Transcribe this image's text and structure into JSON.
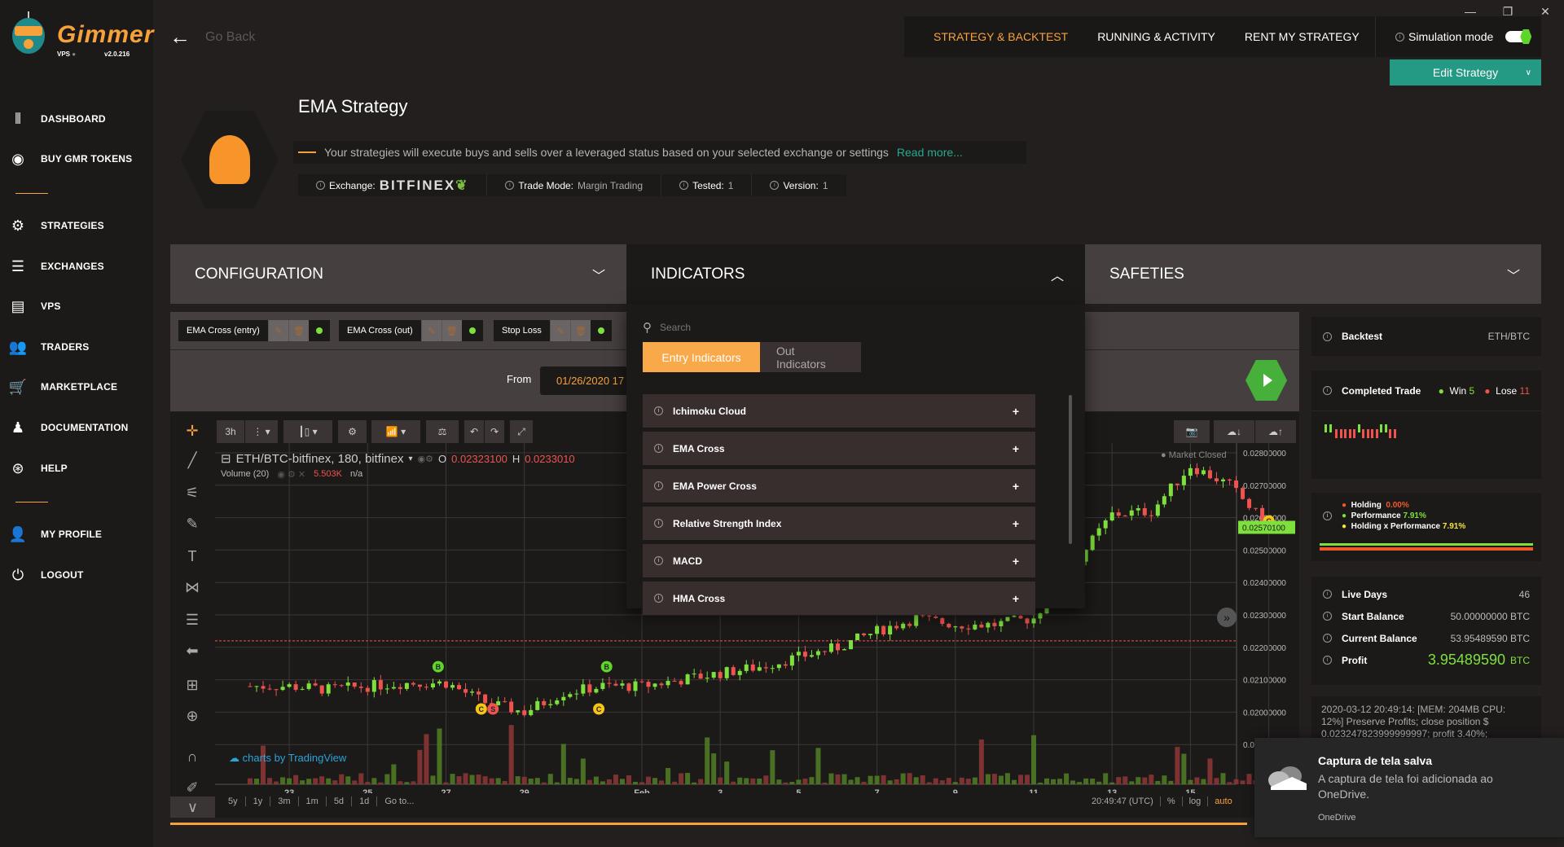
{
  "app": {
    "logo_text": "Gimmer",
    "vps_label": "VPS",
    "version": "v2.0.216"
  },
  "sidebar": {
    "items": [
      {
        "label": "DASHBOARD",
        "icon": "dashboard-icon"
      },
      {
        "label": "BUY GMR TOKENS",
        "icon": "token-icon"
      },
      {
        "label": "STRATEGIES",
        "icon": "strategies-icon"
      },
      {
        "label": "EXCHANGES",
        "icon": "exchanges-icon"
      },
      {
        "label": "VPS",
        "icon": "vps-icon"
      },
      {
        "label": "TRADERS",
        "icon": "traders-icon"
      },
      {
        "label": "MARKETPLACE",
        "icon": "cart-icon"
      },
      {
        "label": "DOCUMENTATION",
        "icon": "documentation-icon"
      },
      {
        "label": "HELP",
        "icon": "help-icon"
      },
      {
        "label": "MY PROFILE",
        "icon": "user-icon"
      },
      {
        "label": "LOGOUT",
        "icon": "power-icon"
      }
    ]
  },
  "header": {
    "go_back": "Go Back",
    "title": "EMA Strategy",
    "description": "Your strategies will execute buys and sells over a leveraged status based on your selected exchange or settings",
    "read_more": "Read more...",
    "info": {
      "exchange_label": "Exchange:",
      "exchange_value": "BITFINEX",
      "trade_mode_label": "Trade Mode:",
      "trade_mode_value": "Margin Trading",
      "tested_label": "Tested:",
      "tested_value": "1",
      "version_label": "Version:",
      "version_value": "1"
    }
  },
  "topnav": {
    "tabs": [
      "STRATEGY & BACKTEST",
      "RUNNING & ACTIVITY",
      "RENT MY STRATEGY"
    ],
    "active": 0,
    "simulation_label": "Simulation mode",
    "simulation_on": true,
    "edit_button": "Edit Strategy"
  },
  "accordions": {
    "configuration": "CONFIGURATION",
    "indicators": "INDICATORS",
    "safeties": "SAFETIES"
  },
  "config": {
    "chips": [
      "EMA Cross (entry)",
      "EMA Cross (out)",
      "Stop Loss"
    ],
    "from_label": "From",
    "from_value": "01/26/2020 17"
  },
  "indicators": {
    "search_placeholder": "Search",
    "tabs": [
      "Entry Indicators",
      "Out Indicators"
    ],
    "active_tab": 0,
    "items": [
      "Ichimoku Cloud",
      "EMA Cross",
      "EMA Power Cross",
      "Relative Strength Index",
      "MACD",
      "HMA Cross"
    ]
  },
  "chart": {
    "interval": "3h",
    "symbol": "ETH/BTC-bitfinex, 180, bitfinex",
    "open_label": "O",
    "open_value": "0.02323100",
    "high_label": "H",
    "high_value": "0.0233010",
    "volume_label": "Volume (20)",
    "volume_value": "5.503K",
    "volume_na": "n/a",
    "market_status": "Market Closed",
    "attribution": "charts by TradingView",
    "ranges": [
      "5y",
      "1y",
      "3m",
      "1m",
      "5d",
      "1d",
      "Go to..."
    ],
    "time": "20:49:47 (UTC)",
    "scale_opts": [
      "%",
      "log",
      "auto"
    ]
  },
  "chart_data": {
    "type": "candlestick",
    "ylim": [
      0.019,
      0.0285
    ],
    "y_ticks": [
      "0.02800000",
      "0.02700000",
      "0.02600000",
      "0.02500000",
      "0.02400000",
      "0.02300000",
      "0.02200000",
      "0.02100000",
      "0.02000000",
      "0.01900000"
    ],
    "x_ticks": [
      "23",
      "25",
      "27",
      "29",
      "Feb",
      "3",
      "5",
      "7",
      "9",
      "11",
      "13",
      "15",
      "17"
    ],
    "dates": [
      "01-22",
      "01-23",
      "01-24",
      "01-25",
      "01-26",
      "01-27",
      "01-28",
      "01-29",
      "01-30",
      "01-31",
      "02-01",
      "02-02",
      "02-03",
      "02-04",
      "02-05",
      "02-06",
      "02-07",
      "02-08",
      "02-09",
      "02-10",
      "02-11",
      "02-12",
      "02-13",
      "02-14",
      "02-15",
      "02-16",
      "02-17"
    ],
    "close": [
      0.0208,
      0.0208,
      0.0207,
      0.0208,
      0.0209,
      0.0209,
      0.0203,
      0.02,
      0.0206,
      0.0208,
      0.0208,
      0.021,
      0.0212,
      0.0214,
      0.0217,
      0.022,
      0.0225,
      0.0229,
      0.0227,
      0.0227,
      0.0229,
      0.0245,
      0.0261,
      0.0262,
      0.0276,
      0.027,
      0.0257
    ],
    "last_price": "0.02570100",
    "stop_line": 0.0222,
    "markers": [
      {
        "date": "01-26.8",
        "label": "B",
        "color": "#5fd42b"
      },
      {
        "date": "01-27.9",
        "label": "C",
        "color": "#f5c518"
      },
      {
        "date": "01-28.2",
        "label": "S",
        "color": "#ef5350"
      },
      {
        "date": "01-30.9",
        "label": "C",
        "color": "#f5c518"
      },
      {
        "date": "01-31.1",
        "label": "B",
        "color": "#5fd42b"
      },
      {
        "date": "02-17",
        "label": "C",
        "color": "#f5c518"
      }
    ]
  },
  "panel": {
    "backtest_label": "Backtest",
    "pair": "ETH/BTC",
    "completed_label": "Completed Trade",
    "win_label": "Win",
    "win": "5",
    "lose_label": "Lose",
    "lose": "11",
    "trade_sequence": [
      "W",
      "W",
      "L",
      "L",
      "L",
      "L",
      "L",
      "W",
      "L",
      "L",
      "L",
      "L",
      "W",
      "W",
      "L",
      "L"
    ],
    "holding_label": "Holding",
    "holding": "0.00%",
    "performance_label": "Performance",
    "performance": "7.91%",
    "hxp_label": "Holding x Performance",
    "hxp": "7.91%",
    "live_days_label": "Live Days",
    "live_days": "46",
    "start_label": "Start Balance",
    "start": "50.00000000 BTC",
    "current_label": "Current Balance",
    "current": "53.95489590 BTC",
    "profit_label": "Profit",
    "profit": "3.95489590",
    "profit_unit": "BTC",
    "log": "2020-03-12 20:49:14: [MEM: 204MB CPU: 12%] Preserve Profits; close position $ 0.023247823999999997; profit 3.40%;"
  },
  "notification": {
    "title": "Captura de tela salva",
    "body": "A captura de tela foi adicionada ao OneDrive.",
    "source": "OneDrive"
  },
  "colors": {
    "accent": "#f7a13b",
    "teal": "#249984",
    "green": "#5fd42b",
    "red": "#ef5350"
  }
}
